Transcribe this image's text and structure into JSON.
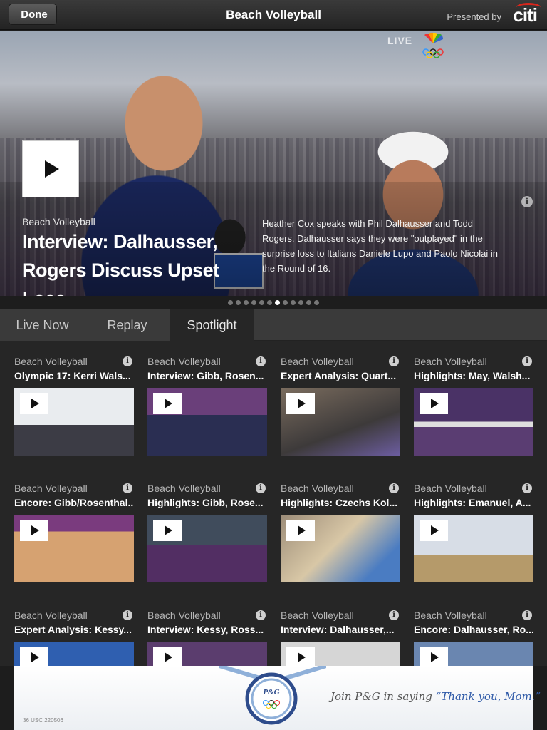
{
  "header": {
    "back_label": "Done",
    "title": "Beach Volleyball",
    "presented_by": "Presented by",
    "sponsor": "citi"
  },
  "hero": {
    "live_label": "LIVE",
    "network_logo": "nbc-peacock-olympic-rings",
    "category": "Beach Volleyball",
    "title": "Interview: Dalhausser, Rogers Discuss Upset Loss",
    "description": "Heather Cox speaks with Phil Dalhausser and Todd Rogers. Dalhausser says they were \"outplayed\" in the surprise loss to Italians Daniele Lupo and Paolo Nicolai in the Round of 16.",
    "info_icon": "i",
    "page_count": 12,
    "active_page": 6
  },
  "tabs": [
    {
      "label": "Live Now",
      "active": false
    },
    {
      "label": "Replay",
      "active": false
    },
    {
      "label": "Spotlight",
      "active": true
    }
  ],
  "videos": [
    {
      "category": "Beach Volleyball",
      "title": "Olympic 17: Kerri Wals..."
    },
    {
      "category": "Beach Volleyball",
      "title": "Interview: Gibb, Rosen..."
    },
    {
      "category": "Beach Volleyball",
      "title": "Expert Analysis: Quart..."
    },
    {
      "category": "Beach Volleyball",
      "title": "Highlights: May, Walsh..."
    },
    {
      "category": "Beach Volleyball",
      "title": "Encore: Gibb/Rosenthal..."
    },
    {
      "category": "Beach Volleyball",
      "title": "Highlights: Gibb, Rose..."
    },
    {
      "category": "Beach Volleyball",
      "title": "Highlights: Czechs Kol..."
    },
    {
      "category": "Beach Volleyball",
      "title": "Highlights: Emanuel, A..."
    },
    {
      "category": "Beach Volleyball",
      "title": "Expert Analysis: Kessy..."
    },
    {
      "category": "Beach Volleyball",
      "title": "Interview: Kessy, Ross..."
    },
    {
      "category": "Beach Volleyball",
      "title": "Interview: Dalhausser,..."
    },
    {
      "category": "Beach Volleyball",
      "title": "Encore: Dalhausser, Ro..."
    }
  ],
  "ad": {
    "brand": "P&G",
    "text_prefix": "Join P&G in saying",
    "text_quote": "“Thank you, Mom.”",
    "code": "36 USC 220506"
  },
  "colors": {
    "background": "#1d1d1d",
    "grid_background": "#262626",
    "tab_bar": "#3a3a3a",
    "active_tab": "#262626",
    "sponsor_arc": "#d9261c",
    "ad_quote": "#2f5aa8"
  }
}
